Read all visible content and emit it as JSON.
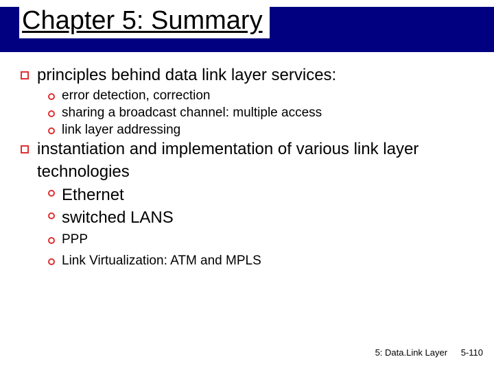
{
  "title": "Chapter 5: Summary",
  "bullets": {
    "b1": "principles behind data link layer services:",
    "b1_subs": {
      "s1": "error detection, correction",
      "s2": "sharing a broadcast channel: multiple access",
      "s3": "link layer addressing"
    },
    "b2": "instantiation and implementation of various link layer technologies",
    "b2_subs": {
      "s1": "Ethernet",
      "s2": "switched LANS",
      "s3": "PPP",
      "s4": "Link Virtualization: ATM and MPLS"
    }
  },
  "footer": {
    "section": "5: Data.Link Layer",
    "page": "5-110"
  }
}
